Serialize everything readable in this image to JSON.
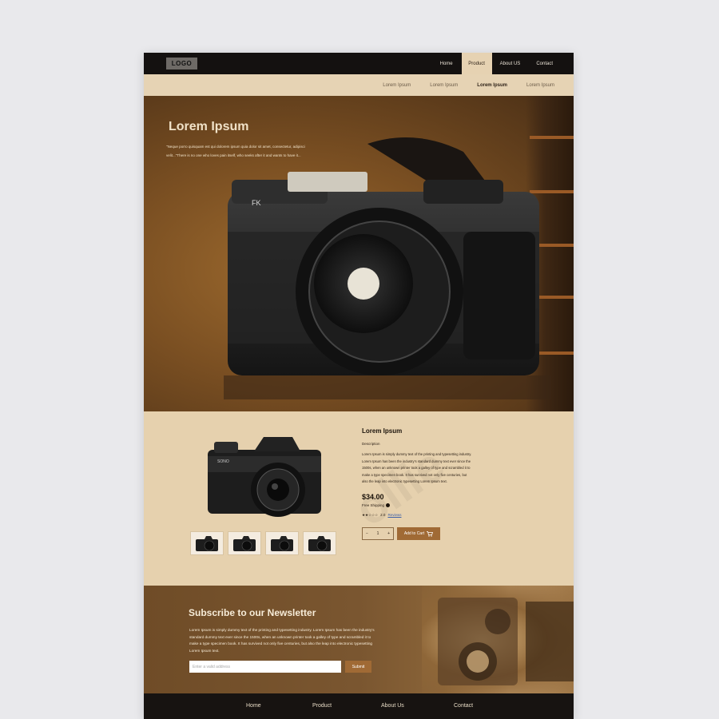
{
  "topnav": {
    "logo": "LOGO",
    "items": [
      "Home",
      "Product",
      "About US",
      "Contact"
    ],
    "active_index": 1
  },
  "subnav": {
    "items": [
      "Lorem Ipsum",
      "Lorem Ipsum",
      "Lorem Ipsum",
      "Lorem Ipsum"
    ],
    "active_index": 2
  },
  "hero": {
    "title": "Lorem Ipsum",
    "text": "\"Neque porro quisquam est qui dolorem ipsum quia dolor sit amet, consectetur, adipisci velit...\"There is no one who loves pain itself, who seeks after it and wants to have it..."
  },
  "product": {
    "title": "Lorem Ipsum",
    "description_label": "Description",
    "description": "Lorem Ipsum is simply dummy text of the printing and typesetting industry. Lorem Ipsum has been the industry's standard dummy text ever since the 1500s, when an unknown printer took a galley of type and scrambled it to make a type specimen book. It has survived not only five centuries, but also the leap into electronic typesetting Lorem Ipsum text.",
    "price": "$34.00",
    "shipping": "Free Shipping",
    "stars": "★★☆☆☆",
    "rating_value": "2.0",
    "reviews_link": "Reviews",
    "quantity": "1",
    "qty_minus": "−",
    "qty_plus": "+",
    "cart_label": "Add to Cart",
    "thumbnail_count": 4
  },
  "newsletter": {
    "title": "Subscribe to our Newsletter",
    "text": "Lorem Ipsum is simply dummy text of the printing and typesetting industry. Lorem Ipsum has been the industry's standard dummy text ever since the 1500s, when an unknown printer took a galley of type and scrambled it to make a type specimen book. It has survived not only five centuries, but also the leap into electronic typesetting Lorem Ipsum text.",
    "input_placeholder": "Enter a valid address",
    "button_label": "Submit"
  },
  "footer": {
    "items": [
      "Home",
      "Product",
      "About Us",
      "Contact"
    ]
  },
  "colors": {
    "accent": "#a06a35",
    "dark": "#141110",
    "beige": "#e6d1ae"
  },
  "icons": [
    "cart-icon",
    "info-icon",
    "star-icon"
  ]
}
